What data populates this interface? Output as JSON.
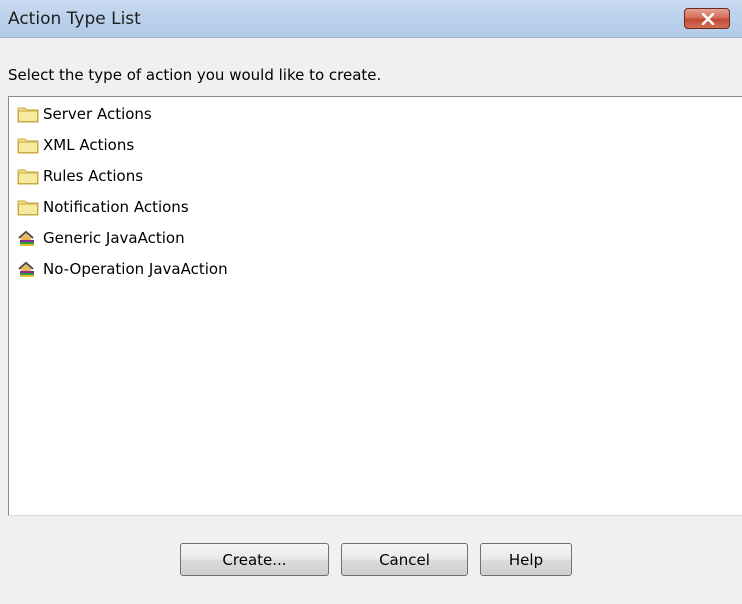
{
  "window": {
    "title": "Action Type List"
  },
  "instruction": "Select the type of action you would like to create.",
  "items": [
    {
      "label": "Server Actions",
      "icon": "folder-icon"
    },
    {
      "label": "XML Actions",
      "icon": "folder-icon"
    },
    {
      "label": "Rules Actions",
      "icon": "folder-icon"
    },
    {
      "label": "Notification Actions",
      "icon": "folder-icon"
    },
    {
      "label": "Generic JavaAction",
      "icon": "java-action-icon"
    },
    {
      "label": "No-Operation JavaAction",
      "icon": "java-action-icon"
    }
  ],
  "buttons": {
    "create": "Create...",
    "cancel": "Cancel",
    "help": "Help"
  },
  "colors": {
    "titlebar": "#bcd2ec",
    "close_button": "#c24a35",
    "list_background": "#ffffff",
    "folder": "#f3e08a"
  }
}
